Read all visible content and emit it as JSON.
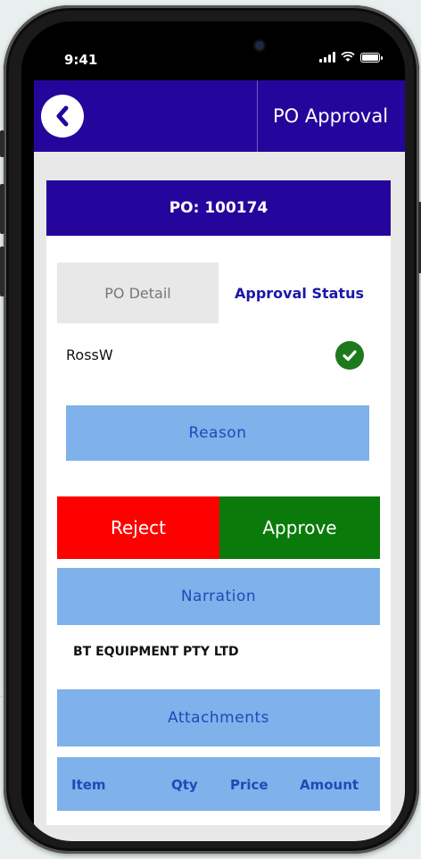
{
  "status_bar": {
    "time": "9:41"
  },
  "header": {
    "title": "PO Approval"
  },
  "po_bar": {
    "label": "PO: 100174"
  },
  "tabs": [
    {
      "label": "PO Detail",
      "active": false
    },
    {
      "label": "Approval Status",
      "active": true
    }
  ],
  "approval": {
    "user": "RossW",
    "status_icon": "check-circle-icon"
  },
  "buttons": {
    "reason": "Reason",
    "reject": "Reject",
    "approve": "Approve",
    "narration": "Narration",
    "attachments": "Attachments"
  },
  "narration_text": "BT EQUIPMENT PTY LTD",
  "table": {
    "columns": [
      "Item",
      "Qty",
      "Price",
      "Amount"
    ]
  },
  "colors": {
    "primary": "#25069c",
    "accent_blue": "#7fb1ea",
    "reject": "#ff0000",
    "approve": "#0a7a0a",
    "check": "#1c7a1c"
  }
}
